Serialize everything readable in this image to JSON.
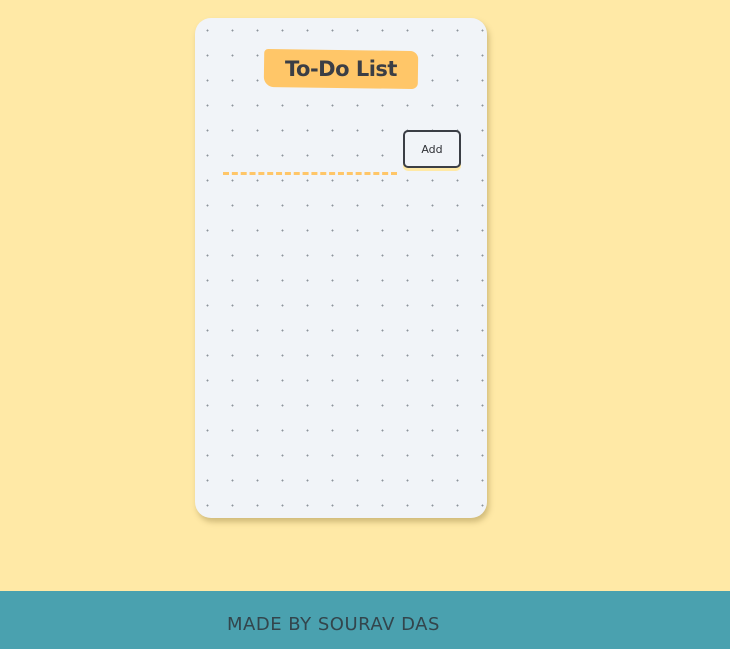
{
  "app": {
    "title": "To-Do List"
  },
  "form": {
    "input_value": "",
    "input_placeholder": "",
    "add_label": "Add"
  },
  "tasks": [],
  "footer": {
    "credit": "MADE BY SOURAV DAS"
  },
  "colors": {
    "page_background": "#ffe9a6",
    "card_background": "#f1f4f8",
    "accent": "#ffc668",
    "footer_background": "#4aa1af",
    "text_dark": "#3b3e45"
  }
}
